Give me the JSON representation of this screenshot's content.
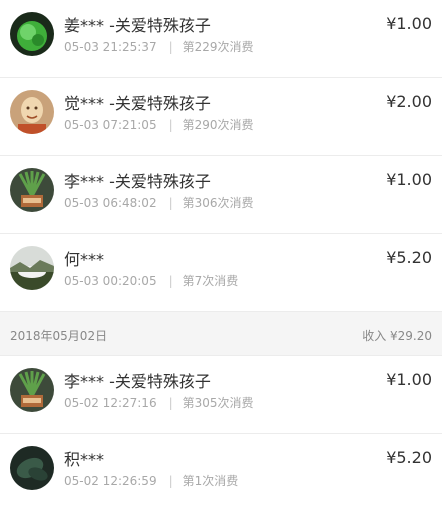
{
  "records_top": [
    {
      "name": "姜*** -关爱特殊孩子",
      "time": "05-03 21:25:37",
      "count": "第229次消费",
      "amount": "¥1.00",
      "avatar": "green-plant-avatar"
    },
    {
      "name": "觉*** -关爱特殊孩子",
      "time": "05-03 07:21:05",
      "count": "第290次消费",
      "amount": "¥2.00",
      "avatar": "buddha-avatar"
    },
    {
      "name": "李*** -关爱特殊孩子",
      "time": "05-03 06:48:02",
      "count": "第306次消费",
      "amount": "¥1.00",
      "avatar": "potted-plant-avatar"
    },
    {
      "name": "何***",
      "time": "05-03 00:20:05",
      "count": "第7次消费",
      "amount": "¥5.20",
      "avatar": "landscape-avatar"
    }
  ],
  "date_group": {
    "date": "2018年05月02日",
    "income": "收入 ¥29.20"
  },
  "records_bottom": [
    {
      "name": "李*** -关爱特殊孩子",
      "time": "05-02 12:27:16",
      "count": "第305次消费",
      "amount": "¥1.00",
      "avatar": "potted-plant-avatar"
    },
    {
      "name": "积***",
      "time": "05-02 12:26:59",
      "count": "第1次消费",
      "amount": "¥5.20",
      "avatar": "dark-leaf-avatar"
    }
  ]
}
